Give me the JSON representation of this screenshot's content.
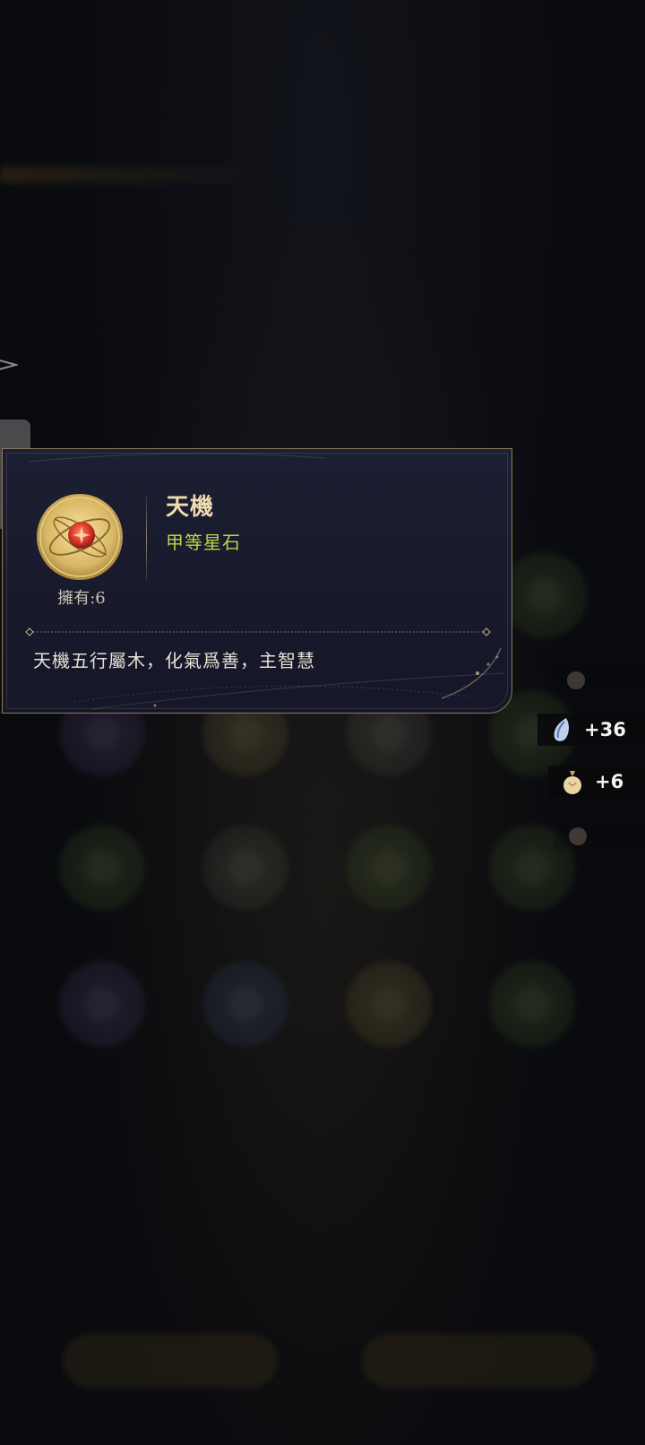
{
  "item": {
    "name": "天機",
    "grade": "甲等星石",
    "owned_label": "擁有:6",
    "description": "天機五行屬木，化氣爲善，主智慧"
  },
  "rewards": [
    {
      "icon": "blue-feather-drop-icon",
      "amount": "+36"
    },
    {
      "icon": "gold-pouch-icon",
      "amount": "+6"
    }
  ],
  "colors": {
    "grade_green": "#b7d64a",
    "name_gold": "#f0dcb0",
    "panel_border": "#8c7a5a",
    "panel_bg": "#1c1f33"
  }
}
